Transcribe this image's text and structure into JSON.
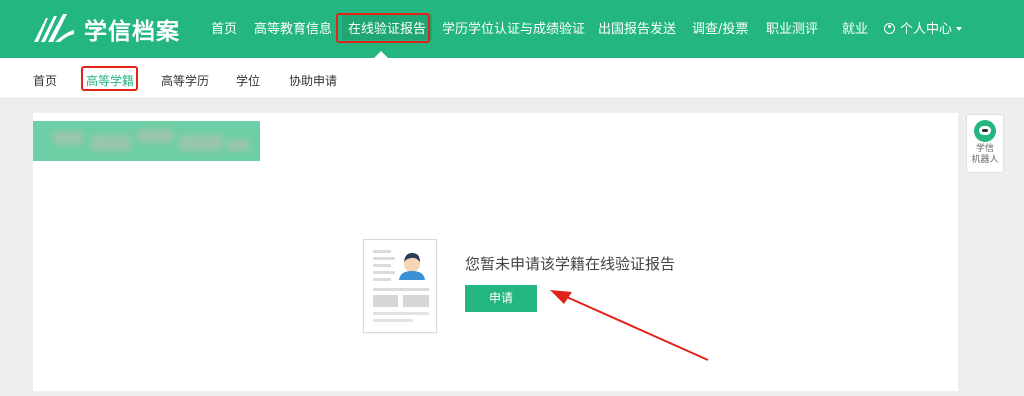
{
  "brand": {
    "name": "学信档案"
  },
  "topnav": {
    "items": [
      "首页",
      "高等教育信息",
      "在线验证报告",
      "学历学位认证与成绩验证",
      "出国报告发送",
      "调查/投票",
      "职业测评",
      "就业"
    ],
    "active_index": 2,
    "user_menu": "个人中心"
  },
  "subnav": {
    "items": [
      "首页",
      "高等学籍",
      "高等学历",
      "学位",
      "协助申请"
    ],
    "active_index": 1
  },
  "main": {
    "message": "您暂未申请该学籍在线验证报告",
    "apply_label": "申请"
  },
  "robot": {
    "line1": "学信",
    "line2": "机器人"
  },
  "colors": {
    "brand_green": "#23b680",
    "annotation_red": "#e2231a"
  }
}
